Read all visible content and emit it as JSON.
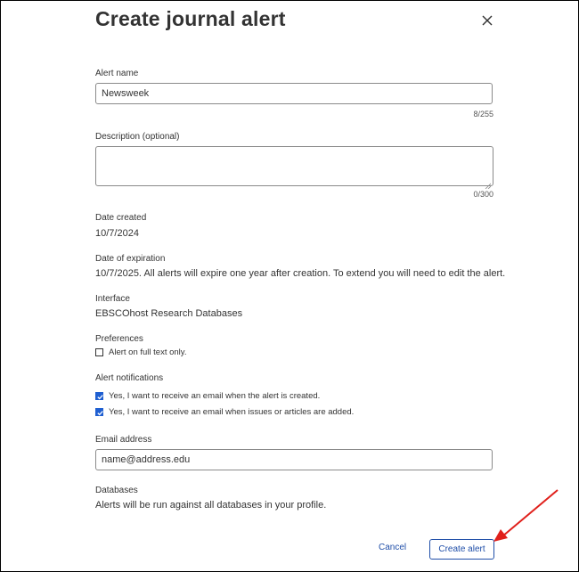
{
  "dialog": {
    "title": "Create journal alert",
    "close_icon": "close-icon"
  },
  "alert_name": {
    "label": "Alert name",
    "value": "Newsweek",
    "counter": "8/255"
  },
  "description": {
    "label": "Description (optional)",
    "value": "",
    "counter": "0/300"
  },
  "date_created": {
    "label": "Date created",
    "value": "10/7/2024"
  },
  "date_expiration": {
    "label": "Date of expiration",
    "value": "10/7/2025. All alerts will expire one year after creation. To extend you will need to edit the alert."
  },
  "interface": {
    "label": "Interface",
    "value": "EBSCOhost Research Databases"
  },
  "preferences": {
    "label": "Preferences",
    "full_text_only": {
      "label": "Alert on full text only.",
      "checked": false
    }
  },
  "notifications": {
    "label": "Alert notifications",
    "on_created": {
      "label": "Yes, I want to receive an email when the alert is created.",
      "checked": true
    },
    "on_added": {
      "label": "Yes, I want to receive an email when issues or articles are added.",
      "checked": true
    }
  },
  "email": {
    "label": "Email address",
    "value": "name@address.edu"
  },
  "databases": {
    "label": "Databases",
    "value": "Alerts will be run against all databases in your profile."
  },
  "actions": {
    "cancel_label": "Cancel",
    "create_label": "Create alert"
  },
  "colors": {
    "accent": "#1f4ea8",
    "checkbox": "#1f5fd1",
    "annotation_arrow": "#e0201b"
  }
}
